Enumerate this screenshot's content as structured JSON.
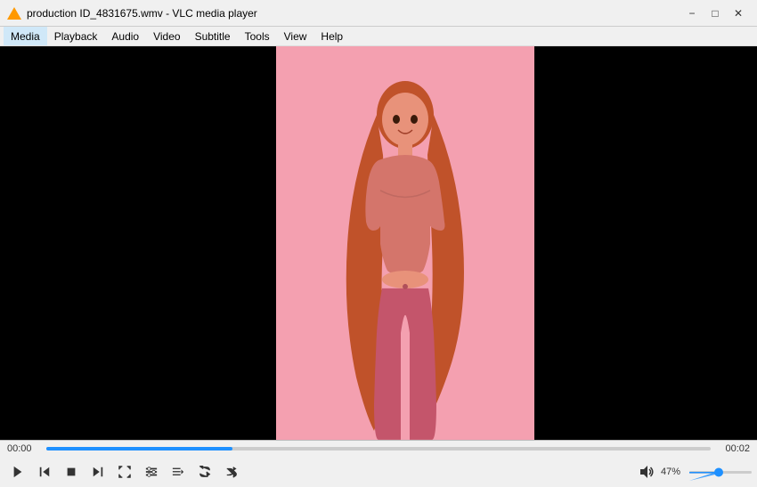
{
  "titlebar": {
    "title": "production ID_4831675.wmv - VLC media player",
    "minimize_label": "−",
    "maximize_label": "□",
    "close_label": "✕"
  },
  "menubar": {
    "items": [
      {
        "id": "media",
        "label": "Media"
      },
      {
        "id": "playback",
        "label": "Playback"
      },
      {
        "id": "audio",
        "label": "Audio"
      },
      {
        "id": "video",
        "label": "Video"
      },
      {
        "id": "subtitle",
        "label": "Subtitle"
      },
      {
        "id": "tools",
        "label": "Tools"
      },
      {
        "id": "view",
        "label": "View"
      },
      {
        "id": "help",
        "label": "Help"
      }
    ]
  },
  "player": {
    "time_left": "00:00",
    "time_right": "00:02",
    "seekbar_pct": 28,
    "volume_pct": "47%"
  }
}
